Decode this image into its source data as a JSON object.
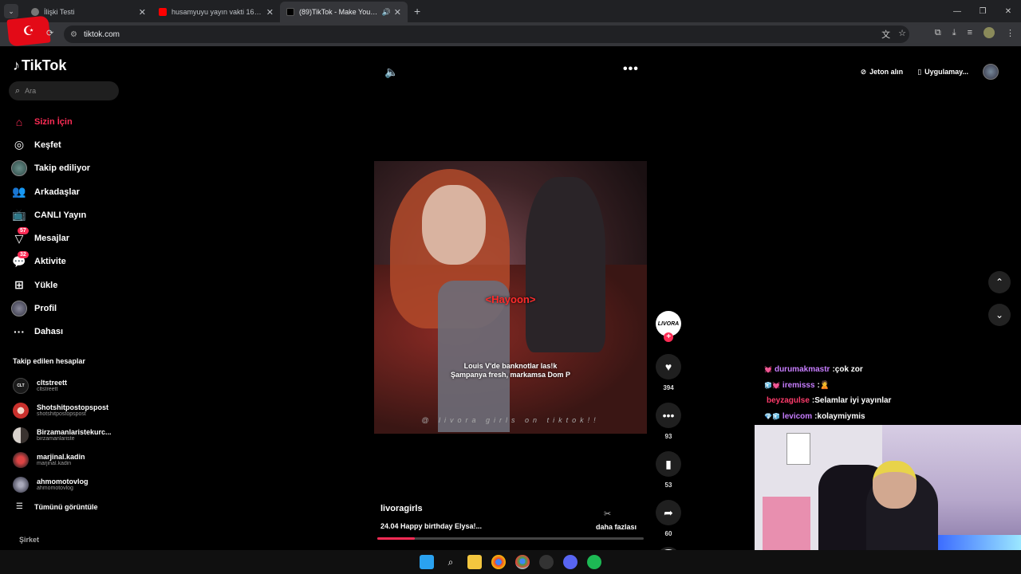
{
  "browser": {
    "tabs": [
      {
        "title": "İlişki Testi",
        "active": false
      },
      {
        "title": "husamyuyu yayın vakti 16 - You",
        "active": false
      },
      {
        "title": "(89)TikTok - Make Your Day",
        "active": true
      }
    ],
    "new_tab": "+",
    "url": "tiktok.com"
  },
  "tiktok": {
    "brand": "TikTok",
    "search_placeholder": "Ara",
    "nav": [
      {
        "label": "Sizin İçin",
        "icon": "home-icon",
        "active": true
      },
      {
        "label": "Keşfet",
        "icon": "compass-icon"
      },
      {
        "label": "Takip ediliyor",
        "icon": "following-avatar-icon"
      },
      {
        "label": "Arkadaşlar",
        "icon": "friends-icon"
      },
      {
        "label": "CANLI Yayın",
        "icon": "live-icon"
      },
      {
        "label": "Mesajlar",
        "icon": "message-icon",
        "badge": "57"
      },
      {
        "label": "Aktivite",
        "icon": "activity-icon",
        "badge": "32"
      },
      {
        "label": "Yükle",
        "icon": "upload-icon"
      },
      {
        "label": "Profil",
        "icon": "profile-avatar-icon"
      },
      {
        "label": "Dahası",
        "icon": "more-icon"
      }
    ],
    "followed_title": "Takip edilen hesaplar",
    "accounts": [
      {
        "name": "cltstreett",
        "handle": "cltstreett",
        "avatar_text": "CLT",
        "color": "#1a1a1a"
      },
      {
        "name": "Shotshitpostopspost",
        "handle": "shotshitpostopspost",
        "avatar_text": "",
        "color": "#c9302c"
      },
      {
        "name": "Birzamanlaristekurc...",
        "handle": "birzamanlariste",
        "avatar_text": "",
        "color": "#d8d2cc"
      },
      {
        "name": "marjinal.kadin",
        "handle": "marjinal.kadin",
        "avatar_text": "",
        "color": "#b4464a"
      },
      {
        "name": "ahmomotovlog",
        "handle": "ahmomotovlog",
        "avatar_text": "",
        "color": "#6f7f8f"
      }
    ],
    "see_all": "Tümünü görüntüle",
    "company": "Şirket",
    "top_right": {
      "coins": "Jeton alın",
      "app": "Uygulamay..."
    },
    "video": {
      "red_caption": "<Hayoon>",
      "lyric_1": "Louis V'de banknotlar las!k",
      "lyric_2": "Şampanya fresh, markamsa Dom P",
      "watermark": "@ livora girls on tiktok!!",
      "creator_avatar": "LIVORA",
      "likes": "394",
      "comments": "93",
      "saves": "53",
      "shares": "60",
      "author": "livoragirls",
      "description": "24.04 Happy birthday Elysa!...",
      "more": "daha fazlası",
      "progress": 0.14
    }
  },
  "stream": {
    "chat": [
      {
        "emotes": "💓",
        "user": "durumakmastr",
        "user_color": "#c77dff",
        "message": "çok zor"
      },
      {
        "emotes": "🧊💓",
        "user": "iremisss",
        "user_color": "#c77dff",
        "message": "🙎"
      },
      {
        "emotes": "",
        "user": "beyzagulse",
        "user_color": "#ff3b6b",
        "message": "Selamlar iyi yayınlar"
      },
      {
        "emotes": "💎🧊",
        "user": "levicom",
        "user_color": "#c77dff",
        "message": "kolaymiymis"
      }
    ]
  }
}
